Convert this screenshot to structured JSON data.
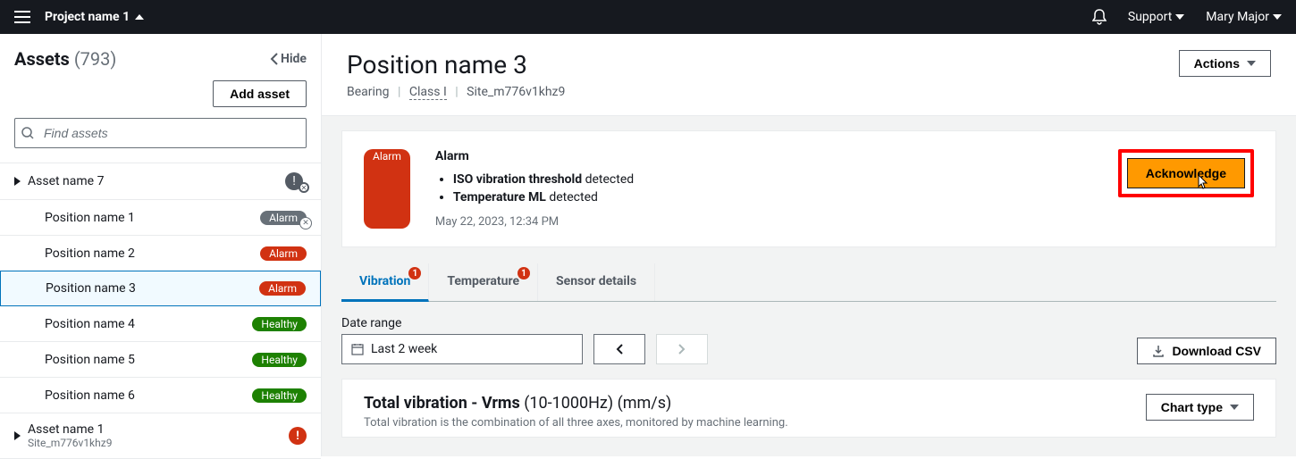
{
  "header": {
    "project_name": "Project name 1",
    "support": "Support",
    "user": "Mary Major"
  },
  "sidebar": {
    "title": "Assets",
    "count": "(793)",
    "hide": "Hide",
    "add_asset": "Add asset",
    "search_placeholder": "Find assets",
    "items": [
      {
        "label": "Asset name 7",
        "expandable": true,
        "status_icon": "warn-ack"
      },
      {
        "label": "Position name 1",
        "level": 1,
        "badge": "Alarm",
        "badge_style": "grey-ack"
      },
      {
        "label": "Position name 2",
        "level": 1,
        "badge": "Alarm",
        "badge_style": "red"
      },
      {
        "label": "Position name 3",
        "level": 1,
        "badge": "Alarm",
        "badge_style": "red",
        "selected": true
      },
      {
        "label": "Position name 4",
        "level": 1,
        "badge": "Healthy",
        "badge_style": "green"
      },
      {
        "label": "Position name 5",
        "level": 1,
        "badge": "Healthy",
        "badge_style": "green"
      },
      {
        "label": "Position name 6",
        "level": 1,
        "badge": "Healthy",
        "badge_style": "green"
      },
      {
        "label": "Asset name 1",
        "expandable": true,
        "sub": "Site_m776v1khz9",
        "status_icon": "red-excl"
      }
    ]
  },
  "content": {
    "title": "Position name 3",
    "breadcrumb": {
      "a": "Bearing",
      "b": "Class I",
      "c": "Site_m776v1khz9"
    },
    "actions": "Actions",
    "alarm": {
      "badge": "Alarm",
      "title": "Alarm",
      "items": [
        {
          "strong": "ISO vibration threshold",
          "rest": " detected"
        },
        {
          "strong": "Temperature ML",
          "rest": " detected"
        }
      ],
      "timestamp": "May 22, 2023, 12:34 PM",
      "ack": "Acknowledge"
    },
    "tabs": [
      {
        "label": "Vibration",
        "badge": "1",
        "active": true
      },
      {
        "label": "Temperature",
        "badge": "1"
      },
      {
        "label": "Sensor details"
      }
    ],
    "date": {
      "label": "Date range",
      "value": "Last 2 week",
      "download": "Download CSV"
    },
    "chart": {
      "title_strong": "Total vibration - Vrms",
      "title_light": " (10-1000Hz) (mm/s)",
      "sub": "Total vibration is the combination of all three axes, monitored by machine learning.",
      "chart_type": "Chart type"
    }
  }
}
